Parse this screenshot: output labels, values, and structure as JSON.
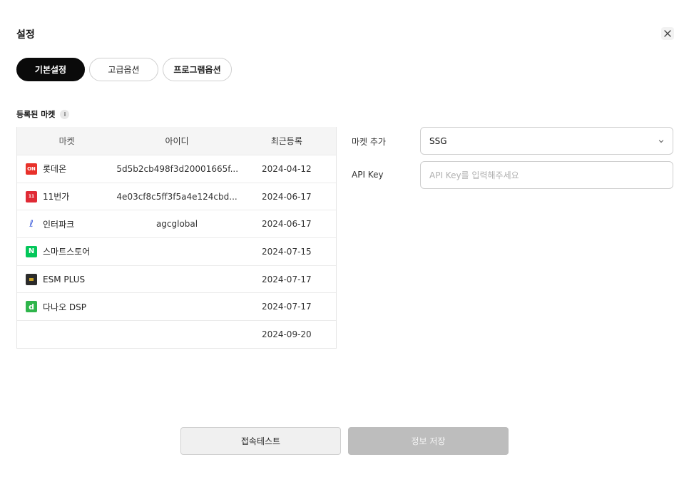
{
  "header": {
    "title": "설정"
  },
  "tabs": [
    {
      "label": "기본설정",
      "active": true
    },
    {
      "label": "고급옵션",
      "active": false
    },
    {
      "label": "프로그램옵션",
      "active": false
    }
  ],
  "markets_section": {
    "label": "등록된 마켓",
    "info_icon": "i"
  },
  "table": {
    "headers": [
      "마켓",
      "아이디",
      "최근등록"
    ],
    "rows": [
      {
        "logo": "ON",
        "name": "롯데온",
        "id": "5d5b2cb498f3d20001665f...",
        "date": "2024-04-12"
      },
      {
        "logo": "11",
        "name": "11번가",
        "id": "4e03cf8c5ff3f5a4e124cbd...",
        "date": "2024-06-17"
      },
      {
        "logo": "ℓ",
        "name": "인터파크",
        "id": "agcglobal",
        "date": "2024-06-17"
      },
      {
        "logo": "N",
        "name": "스마트스토어",
        "id": "",
        "date": "2024-07-15"
      },
      {
        "logo": "",
        "name": "ESM PLUS",
        "id": "",
        "date": "2024-07-17"
      },
      {
        "logo": "d",
        "name": "다나오 DSP",
        "id": "",
        "date": "2024-07-17"
      },
      {
        "logo": "",
        "name": "",
        "id": "",
        "date": "2024-09-20"
      }
    ]
  },
  "form": {
    "market_add_label": "마켓 추가",
    "market_selected": "SSG",
    "api_key_label": "API Key",
    "api_key_placeholder": "API Key를 입력해주세요",
    "api_key_value": ""
  },
  "buttons": {
    "test_label": "접속테스트",
    "save_label": "정보 저장"
  }
}
